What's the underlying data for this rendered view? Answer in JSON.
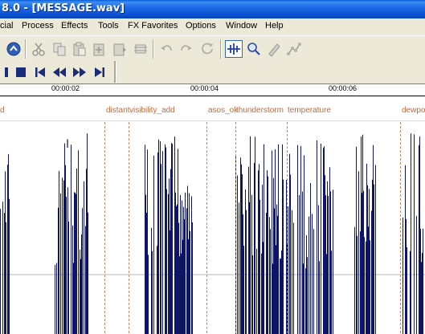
{
  "window": {
    "title": "8.0 - [MESSAGE.wav]"
  },
  "menu": [
    "cial",
    "Process",
    "Effects",
    "Tools",
    "FX Favorites",
    "Options",
    "Window",
    "Help"
  ],
  "toolbar_top": {
    "items": [
      {
        "name": "record-icon",
        "state": "enabled"
      },
      {
        "name": "cut-icon",
        "state": "disabled"
      },
      {
        "name": "copy-icon",
        "state": "disabled"
      },
      {
        "name": "paste-icon",
        "state": "disabled"
      },
      {
        "name": "paste-insert-icon",
        "state": "disabled"
      },
      {
        "name": "mix-paste-icon",
        "state": "disabled"
      },
      {
        "name": "crop-icon",
        "state": "disabled"
      },
      {
        "name": "undo-icon",
        "state": "disabled"
      },
      {
        "name": "redo-icon",
        "state": "disabled"
      },
      {
        "name": "repeat-icon",
        "state": "disabled"
      },
      {
        "name": "edit-tool-icon",
        "state": "active"
      },
      {
        "name": "magnify-tool-icon",
        "state": "enabled"
      },
      {
        "name": "pencil-tool-icon",
        "state": "disabled"
      },
      {
        "name": "envelope-tool-icon",
        "state": "disabled"
      }
    ]
  },
  "transport": [
    {
      "name": "pause-icon"
    },
    {
      "name": "stop-icon"
    },
    {
      "name": "go-to-start-icon"
    },
    {
      "name": "rewind-icon"
    },
    {
      "name": "fast-forward-icon"
    },
    {
      "name": "go-to-end-icon"
    }
  ],
  "timeline": {
    "labels": [
      "00:00:02",
      "00:00:04",
      "00:00:06"
    ]
  },
  "markers": [
    {
      "label": "d",
      "has_flag": false
    },
    {
      "label": "distant",
      "has_flag": true
    },
    {
      "label": "visibility_add",
      "has_flag": true
    },
    {
      "label": "asos_ok",
      "has_flag": true
    },
    {
      "label": "thunderstorm",
      "has_flag": true
    },
    {
      "label": "temperature",
      "has_flag": true
    },
    {
      "label": "dewpo",
      "has_flag": true
    }
  ],
  "colors": {
    "waveform": "#0e1566",
    "marker_line": "#d9845a",
    "marker_label": "#c06a3a",
    "title_bar": "#0d55d6"
  }
}
